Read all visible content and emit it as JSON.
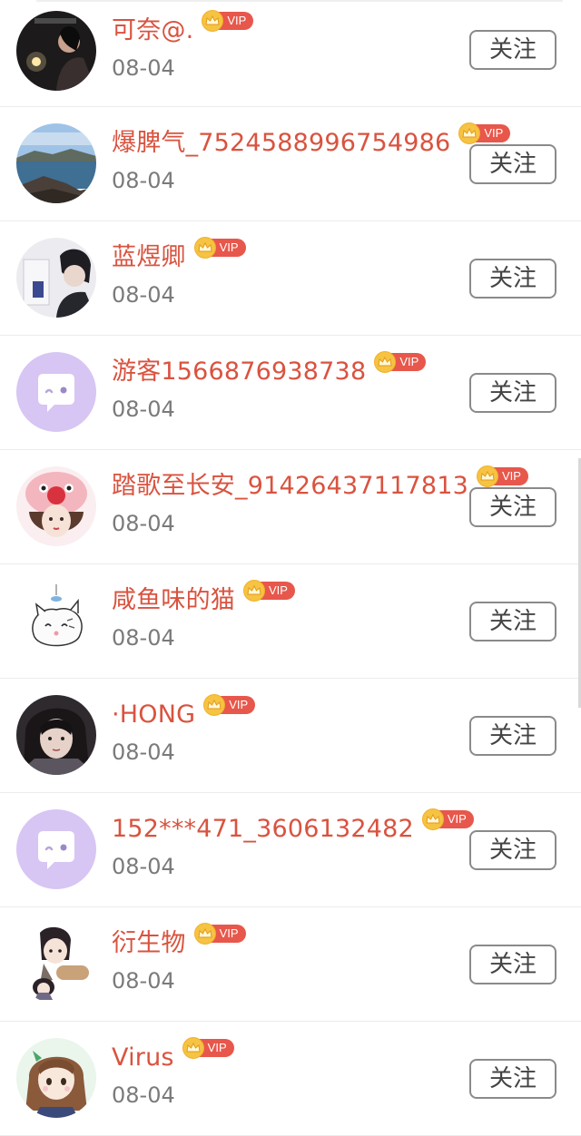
{
  "follow_label": "关注",
  "vip_label": "VIP",
  "users": [
    {
      "name": "可奈@.",
      "date": "08-04",
      "avatar": "photo-dark"
    },
    {
      "name": "爆脾气_7524588996754986",
      "date": "08-04",
      "avatar": "lake"
    },
    {
      "name": "蓝煜卿",
      "date": "08-04",
      "avatar": "room"
    },
    {
      "name": "游客1566876938738",
      "date": "08-04",
      "avatar": "default"
    },
    {
      "name": "踏歌至长安_91426437117813",
      "date": "08-04",
      "avatar": "girl-hat"
    },
    {
      "name": "咸鱼味的猫",
      "date": "08-04",
      "avatar": "cat"
    },
    {
      "name": "·HONG",
      "date": "08-04",
      "avatar": "anime-dark"
    },
    {
      "name": "152***471_3606132482",
      "date": "08-04",
      "avatar": "default"
    },
    {
      "name": "衍生物",
      "date": "08-04",
      "avatar": "chibi"
    },
    {
      "name": "Virus",
      "date": "08-04",
      "avatar": "girl-green"
    }
  ],
  "colors": {
    "name": "#d9533f",
    "vip_tag": "#e8574b",
    "crown": "#f6c342",
    "date": "#7a7a7a",
    "default_avatar": "#d7c5f4"
  }
}
